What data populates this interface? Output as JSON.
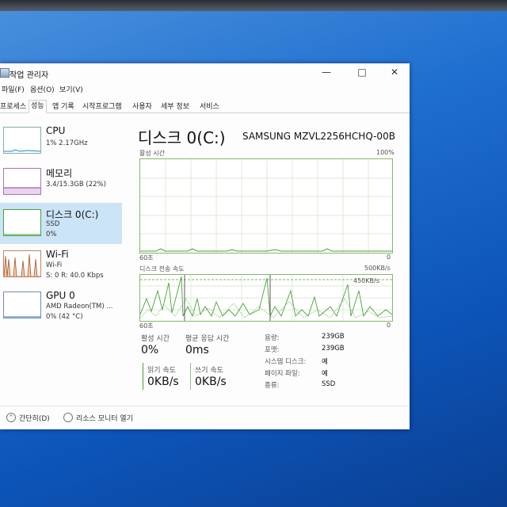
{
  "window": {
    "title": "작업 관리자",
    "controls": {
      "minimize": "—",
      "maximize": "□",
      "close": "✕"
    }
  },
  "menu": [
    "파일(F)",
    "옵션(O)",
    "보기(V)"
  ],
  "tabs": [
    "프로세스",
    "성능",
    "앱 기록",
    "시작프로그램",
    "사용자",
    "세부 정보",
    "서비스"
  ],
  "active_tab": "성능",
  "sidebar": {
    "items": [
      {
        "name": "CPU",
        "sub1": "1% 2.17GHz",
        "sub2": ""
      },
      {
        "name": "메모리",
        "sub1": "3.4/15.3GB (22%)",
        "sub2": ""
      },
      {
        "name": "디스크 0(C:)",
        "sub1": "SSD",
        "sub2": "0%"
      },
      {
        "name": "Wi-Fi",
        "sub1": "Wi-Fi",
        "sub2": "S: 0 R: 40.0 Kbps"
      },
      {
        "name": "GPU 0",
        "sub1": "AMD Radeon(TM) ...",
        "sub2": "0% (42 °C)"
      }
    ]
  },
  "main": {
    "title": "디스크 0(C:)",
    "model": "SAMSUNG MZVL2256HCHQ-00B",
    "active_time": {
      "label": "활성 시간",
      "max": "100%",
      "xlabel": "60초",
      "xmin": "0"
    },
    "transfer": {
      "label": "디스크 전송 속도",
      "max": "500KB/s",
      "mid": "450KB/s",
      "xlabel": "60초",
      "xmin": "0"
    },
    "stats": {
      "active_time_label": "활성 시간",
      "active_time_value": "0%",
      "avg_response_label": "평균 응답 시간",
      "avg_response_value": "0ms",
      "read_label": "읽기 속도",
      "read_value": "0KB/s",
      "write_label": "쓰기 속도",
      "write_value": "0KB/s"
    },
    "properties": [
      {
        "k": "용량:",
        "v": "239GB"
      },
      {
        "k": "포맷:",
        "v": "239GB"
      },
      {
        "k": "시스템 디스크:",
        "v": "예"
      },
      {
        "k": "페이지 파일:",
        "v": "예"
      },
      {
        "k": "종류:",
        "v": "SSD"
      }
    ]
  },
  "footer": {
    "collapse": "간단히(D)",
    "resource_monitor": "리소스 모니터 열기"
  },
  "colors": {
    "accent_disk": "#4ca03a",
    "selected_bg": "#cce4f7",
    "desktop": "#1f6fd0"
  }
}
